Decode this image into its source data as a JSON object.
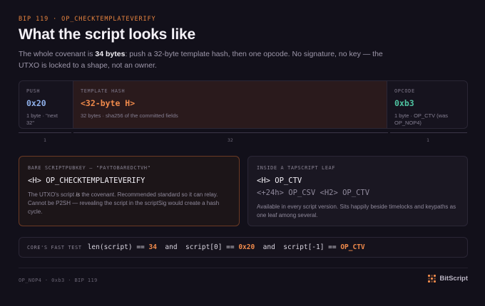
{
  "header": {
    "eyebrow": "BIP 119 · OP_CHECKTEMPLATEVERIFY",
    "title": "What the script looks like",
    "lead_pre": "The whole covenant is ",
    "lead_bold": "34 bytes",
    "lead_post": ": push a 32-byte template hash, then one opcode. No signature, no key — the UTXO is locked to a shape, not an owner."
  },
  "bytes": [
    {
      "label": "PUSH",
      "code": "0x20",
      "desc": "1 byte · \"next 32\"",
      "size": "1"
    },
    {
      "label": "TEMPLATE HASH",
      "code": "<32-byte H>",
      "desc": "32 bytes · sha256 of the committed fields",
      "size": "32"
    },
    {
      "label": "OPCODE",
      "code": "0xb3",
      "desc": "1 byte · OP_CTV (was OP_NOP4)",
      "size": "1"
    }
  ],
  "panels": {
    "bare": {
      "label": "BARE SCRIPTPUBKEY — \"PAYTOBAREDCTVH\"",
      "code": "<H> OP_CHECKTEMPLATEVERIFY",
      "text_pre": "The UTXO's script ",
      "text_em": "is",
      "text_post": " the covenant. Recommended standard so it can relay. Cannot be P2SH — revealing the script in the scriptSig would create a hash cycle."
    },
    "tapscript": {
      "label": "INSIDE A TAPSCRIPT LEAF",
      "code": "<H> OP_CTV",
      "code2": "<+24h> OP_CSV <H2> OP_CTV",
      "text": "Available in every script version. Sits happily beside timelocks and keypaths as one leaf among several."
    }
  },
  "test": {
    "label": "CORE'S FAST TEST",
    "p1": "len(script) == ",
    "v1": "34",
    "p2": "  and  script[0] == ",
    "v2": "0x20",
    "p3": "  and  script[-1] == ",
    "v3": "OP_CTV"
  },
  "footer": {
    "left": "OP_NOP4 · 0xb3 · BIP 119",
    "brand": "BitScript"
  },
  "colors": {
    "accent": "#f08a4b",
    "blue": "#8fb0ea",
    "green": "#4fc4a2"
  }
}
